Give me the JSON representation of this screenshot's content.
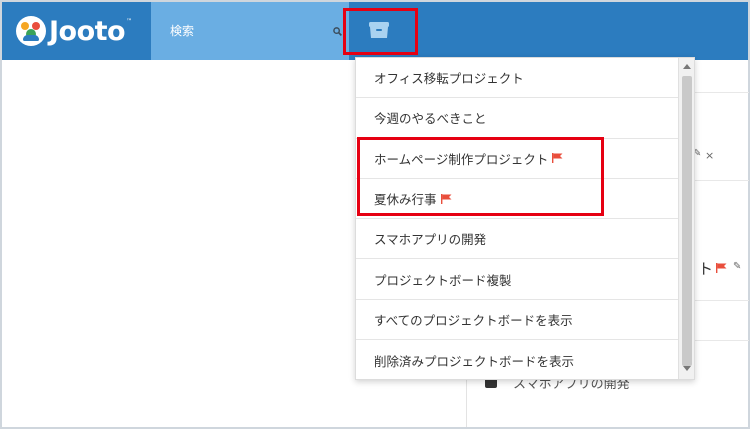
{
  "header": {
    "logo_text": "Jooto",
    "logo_tm": "™",
    "search_placeholder": "検索"
  },
  "icons": {
    "search": "search-icon",
    "projects": "project-box-icon",
    "flag": "flag-icon",
    "close": "close-icon",
    "pencil": "pencil-icon"
  },
  "colors": {
    "header": "#2c7cbf",
    "search_bg": "#6aaee3",
    "highlight": "#e60012",
    "flag": "#e94e3c"
  },
  "dropdown": {
    "items": [
      {
        "label": "オフィス移転プロジェクト",
        "flag": false
      },
      {
        "label": "今週のやるべきこと",
        "flag": false
      },
      {
        "label": "ホームページ制作プロジェクト",
        "flag": true
      },
      {
        "label": "夏休み行事",
        "flag": true
      },
      {
        "label": "スマホアプリの開発",
        "flag": false
      },
      {
        "label": "プロジェクトボード複製",
        "flag": false
      },
      {
        "label": "すべてのプロジェクトボードを表示",
        "flag": false
      },
      {
        "label": "削除済みプロジェクトボードを表示",
        "flag": false
      }
    ]
  },
  "background": {
    "partial_text": "ト",
    "bottom_text": "スマホアプリの開発"
  }
}
